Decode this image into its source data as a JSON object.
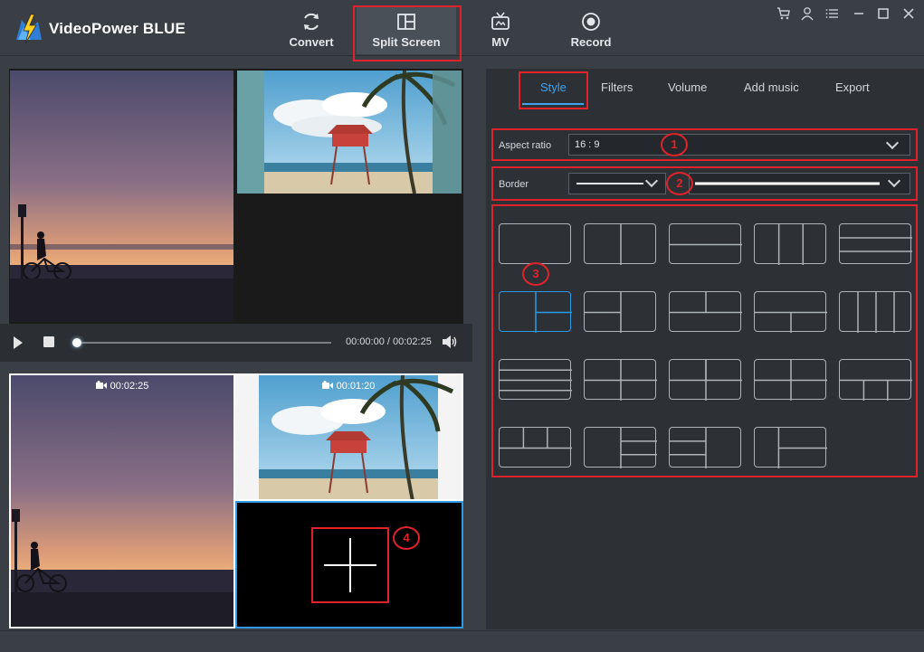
{
  "app": {
    "title": "VideoPower BLUE"
  },
  "nav": {
    "items": [
      {
        "label": "Convert",
        "icon": "refresh-icon"
      },
      {
        "label": "Split Screen",
        "icon": "split-screen-icon"
      },
      {
        "label": "MV",
        "icon": "tv-icon"
      },
      {
        "label": "Record",
        "icon": "record-icon"
      }
    ],
    "active": "Split Screen"
  },
  "window_controls": [
    "cart-icon",
    "user-icon",
    "menu-icon",
    "minimize-icon",
    "maximize-icon",
    "close-icon"
  ],
  "player": {
    "time": "00:00:00 / 00:02:25",
    "progress": 0
  },
  "editor": {
    "clips": [
      {
        "duration": "00:02:25"
      },
      {
        "duration": "00:01:20"
      }
    ]
  },
  "panel": {
    "tabs": [
      "Style",
      "Filters",
      "Volume",
      "Add music",
      "Export"
    ],
    "active_tab": "Style",
    "aspect_ratio": {
      "label": "Aspect ratio",
      "value": "16 : 9"
    },
    "border": {
      "label": "Border"
    },
    "selected_layout_index": 5
  },
  "annotations": [
    "1",
    "2",
    "3",
    "4"
  ],
  "colors": {
    "accent": "#3ea2ee",
    "highlight": "#e0222a",
    "panel": "#2d3136"
  }
}
